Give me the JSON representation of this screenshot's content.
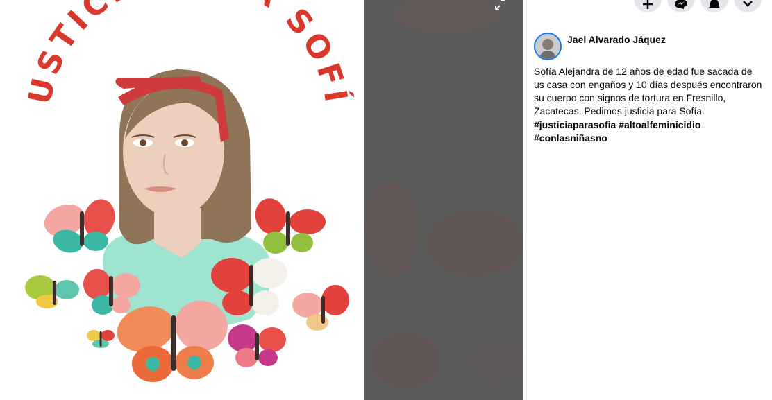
{
  "artwork": {
    "title_text": "¡JUSTICIA PARA SOFÍA!",
    "colors": {
      "title": "#d9392d",
      "hair": "#8f7457",
      "skin": "#ecd0bd",
      "headband": "#cf3a3d",
      "shirt": "#9fe3d1"
    }
  },
  "viewer": {
    "collapse_icon": "collapse-arrows-icon"
  },
  "actions": [
    {
      "icon": "plus-icon"
    },
    {
      "icon": "messenger-icon"
    },
    {
      "icon": "bell-icon"
    },
    {
      "icon": "chevron-down-icon"
    }
  ],
  "post": {
    "author": "Jael Alvarado Jáquez",
    "body": "Sofía Alejandra de 12 años de edad fue sacada de us casa con engaños y 10 días después encontraron su cuerpo con signos de tortura en Fresnillo, Zacatecas. Pedimos justicia para Sofía.",
    "hashtags": [
      "#justiciaparasofia",
      "#altoalfeminicidio",
      "#conlasniñasno"
    ]
  }
}
